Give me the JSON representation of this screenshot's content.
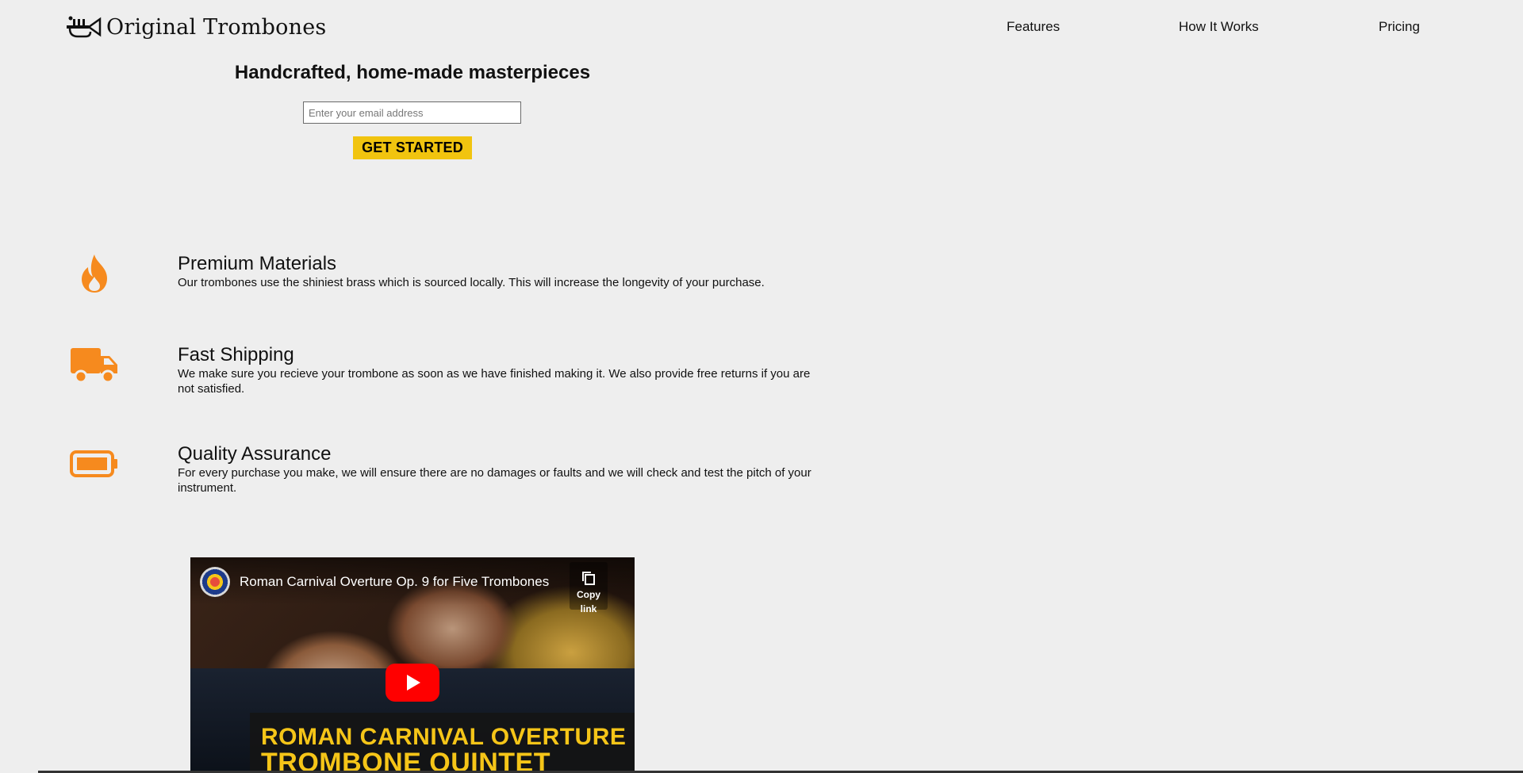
{
  "brand": {
    "name": "Original Trombones",
    "logo_icon": "trumpet-logo-icon"
  },
  "nav": {
    "items": [
      "Features",
      "How It Works",
      "Pricing"
    ]
  },
  "hero": {
    "title": "Handcrafted, home-made masterpieces",
    "email_placeholder": "Enter your email address",
    "cta_label": "GET STARTED",
    "cta_color": "#f1c40f"
  },
  "features": [
    {
      "icon": "fire-icon",
      "title": "Premium Materials",
      "text": "Our trombones use the shiniest brass which is sourced locally. This will increase the longevity of your purchase."
    },
    {
      "icon": "truck-icon",
      "title": "Fast Shipping",
      "text": "We make sure you recieve your trombone as soon as we have finished making it. We also provide free returns if you are not satisfied."
    },
    {
      "icon": "battery-icon",
      "title": "Quality Assurance",
      "text": "For every purchase you make, we will ensure there are no damages or faults and we will check and test the pitch of your instrument."
    }
  ],
  "accent_color": "#f68a1e",
  "video": {
    "title": "Roman Carnival Overture Op. 9 for Five Trombones",
    "copy_link_label": "Copy link",
    "banner_line1": "ROMAN CARNIVAL OVERTURE",
    "banner_line2": "TROMBONE QUINTET"
  }
}
